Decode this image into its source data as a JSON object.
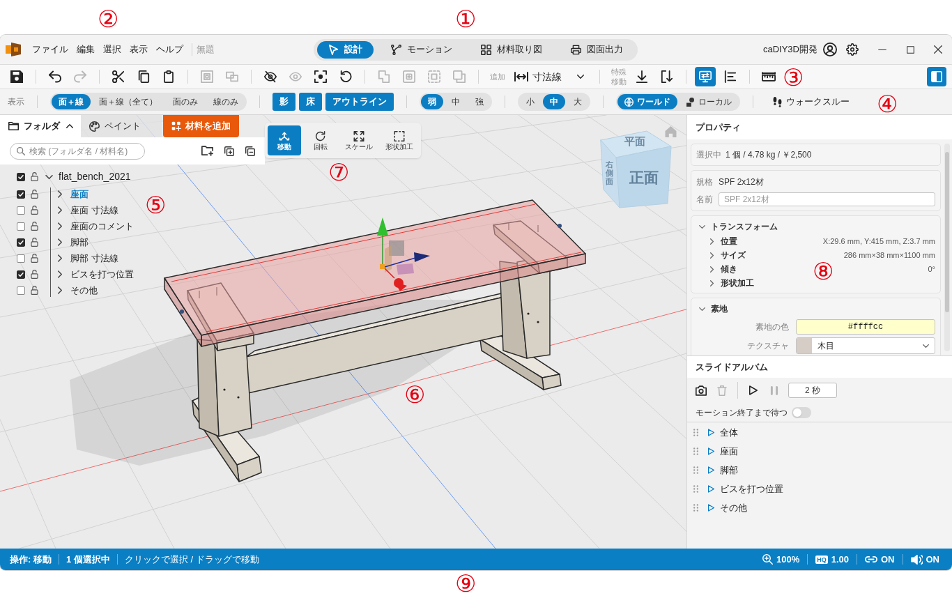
{
  "menu_bar": {
    "callout": "②",
    "items": [
      "ファイル",
      "編集",
      "選択",
      "表示",
      "ヘルプ"
    ],
    "document_title": "無題"
  },
  "mode_tabs": {
    "callout": "①",
    "tabs": [
      {
        "label": "設計",
        "selected": true
      },
      {
        "label": "モーション",
        "selected": false
      },
      {
        "label": "材料取り図",
        "selected": false
      },
      {
        "label": "図面出力",
        "selected": false
      }
    ]
  },
  "account": {
    "user_name": "caDIY3D開発"
  },
  "toolbar": {
    "callout": "③",
    "groups": [
      [
        {
          "kind": "icon",
          "disabled": false
        }
      ],
      [
        {
          "kind": "icon",
          "disabled": false
        },
        {
          "kind": "icon",
          "disabled": true
        }
      ],
      [
        {
          "kind": "icon",
          "disabled": false
        },
        {
          "kind": "icon",
          "disabled": false
        },
        {
          "kind": "icon",
          "disabled": false
        }
      ],
      [
        {
          "kind": "icon",
          "disabled": true
        },
        {
          "kind": "icon",
          "disabled": true
        }
      ],
      [
        {
          "kind": "icon",
          "disabled": false
        },
        {
          "kind": "icon",
          "disabled": true
        },
        {
          "kind": "icon",
          "disabled": false
        },
        {
          "kind": "icon",
          "disabled": false
        }
      ],
      [
        {
          "kind": "icon",
          "disabled": true
        },
        {
          "kind": "icon",
          "disabled": true
        },
        {
          "kind": "icon",
          "disabled": true
        },
        {
          "kind": "icon",
          "disabled": true
        }
      ],
      [
        {
          "kind": "label",
          "text": "追加"
        },
        {
          "kind": "text_button",
          "text": "寸法線"
        },
        {
          "kind": "icon",
          "disabled": false
        }
      ],
      [
        {
          "kind": "label",
          "text": "特殊移動"
        },
        {
          "kind": "icon",
          "disabled": false
        },
        {
          "kind": "icon",
          "disabled": false
        }
      ],
      [
        {
          "kind": "toggle",
          "on": true
        },
        {
          "kind": "toggle",
          "on": false
        }
      ],
      [
        {
          "kind": "icon",
          "disabled": false
        }
      ]
    ],
    "panel_toggle": {
      "on": true
    }
  },
  "display_bar": {
    "callout": "④",
    "label": "表示",
    "render_mode": [
      {
        "label": "面＋線",
        "selected": true
      },
      {
        "label": "面＋線（全て）",
        "selected": false
      },
      {
        "label": "面のみ",
        "selected": false
      },
      {
        "label": "線のみ",
        "selected": false
      }
    ],
    "toggles": [
      {
        "label": "影",
        "on": true
      },
      {
        "label": "床",
        "on": true
      },
      {
        "label": "アウトライン",
        "on": true
      }
    ],
    "strength": [
      {
        "label": "弱",
        "selected": true
      },
      {
        "label": "中",
        "selected": false
      },
      {
        "label": "強",
        "selected": false
      }
    ],
    "size": [
      {
        "label": "小",
        "selected": false
      },
      {
        "label": "中",
        "selected": true
      },
      {
        "label": "大",
        "selected": false
      }
    ],
    "space": [
      {
        "label": "ワールド",
        "selected": true
      },
      {
        "label": "ローカル",
        "selected": false
      }
    ],
    "walkthrough": "ウォークスルー"
  },
  "side_panel": {
    "expanded": true,
    "tabs": [
      {
        "label": "フォルダ",
        "selected": true
      },
      {
        "label": "ペイント",
        "selected": false
      }
    ],
    "add_material_button": "材料を追加",
    "search": {
      "placeholder": "検索 (フォルダ名 / 材料名)"
    }
  },
  "folder_tree": {
    "callout": "⑤",
    "root": {
      "label": "flat_bench_2021",
      "checked": true,
      "locked": false,
      "expanded": true,
      "selected": false,
      "children": [
        {
          "label": "座面",
          "checked": true,
          "locked": false,
          "expanded": false,
          "selected": true
        },
        {
          "label": "座面 寸法線",
          "checked": false,
          "locked": false,
          "expanded": false,
          "selected": false
        },
        {
          "label": "座面のコメント",
          "checked": false,
          "locked": false,
          "expanded": false,
          "selected": false
        },
        {
          "label": "脚部",
          "checked": true,
          "locked": false,
          "expanded": false,
          "selected": false
        },
        {
          "label": "脚部 寸法線",
          "checked": false,
          "locked": false,
          "expanded": false,
          "selected": false
        },
        {
          "label": "ビスを打つ位置",
          "checked": true,
          "locked": false,
          "expanded": false,
          "selected": false
        },
        {
          "label": "その他",
          "checked": false,
          "locked": false,
          "expanded": false,
          "selected": false
        }
      ]
    }
  },
  "viewport": {
    "callout": "⑥",
    "view_cube": {
      "top": "平面",
      "front": "正面",
      "side": "右側面"
    }
  },
  "transform_tools": {
    "callout": "⑦",
    "tools": [
      {
        "label": "移動",
        "selected": true
      },
      {
        "label": "回転",
        "selected": false
      },
      {
        "label": "スケール",
        "selected": false
      },
      {
        "label": "形状加工",
        "selected": false
      }
    ]
  },
  "properties": {
    "callout": "⑧",
    "title": "プロパティ",
    "selection": {
      "label": "選択中",
      "value": "1 個 / 4.78 kg / ￥2,500"
    },
    "spec": {
      "label": "規格",
      "value": "SPF 2x12材"
    },
    "name": {
      "label": "名前",
      "placeholder": "SPF 2x12材"
    },
    "transform": {
      "title": "トランスフォーム",
      "expanded": true,
      "rows": [
        {
          "label": "位置",
          "value": "X:29.6 mm, Y:415 mm, Z:3.7 mm",
          "expanded": false
        },
        {
          "label": "サイズ",
          "value": "286 mm×38 mm×1100 mm",
          "expanded": false
        },
        {
          "label": "傾き",
          "value": "0°",
          "expanded": false
        },
        {
          "label": "形状加工",
          "expanded": false
        }
      ]
    },
    "base": {
      "title": "素地",
      "expanded": true,
      "color": {
        "label": "素地の色",
        "value": "#ffffcc"
      },
      "texture": {
        "label": "テクスチャ",
        "value": "木目"
      }
    }
  },
  "slide_album": {
    "title": "スライドアルバム",
    "controls": [
      {
        "disabled": false
      },
      {
        "disabled": true
      },
      {
        "disabled": false
      },
      {
        "disabled": true
      }
    ],
    "interval": "2 秒",
    "wait_for_motion": {
      "label": "モーション終了まで待つ",
      "on": false
    },
    "slides": [
      "全体",
      "座面",
      "脚部",
      "ビスを打つ位置",
      "その他"
    ]
  },
  "status_bar": {
    "callout": "⑨",
    "items": [
      {
        "text": "操作: 移動",
        "kind": "status"
      },
      {
        "text": "1 個選択中",
        "kind": "status"
      },
      {
        "text": "クリックで選択 / ドラッグで移動",
        "kind": "hint"
      }
    ],
    "indicators": [
      {
        "kind": "zoom",
        "value": "100%"
      },
      {
        "kind": "quality",
        "badge": "HQ",
        "value": "1.00"
      },
      {
        "kind": "link",
        "value": "ON"
      },
      {
        "kind": "sound",
        "value": "ON"
      }
    ]
  }
}
